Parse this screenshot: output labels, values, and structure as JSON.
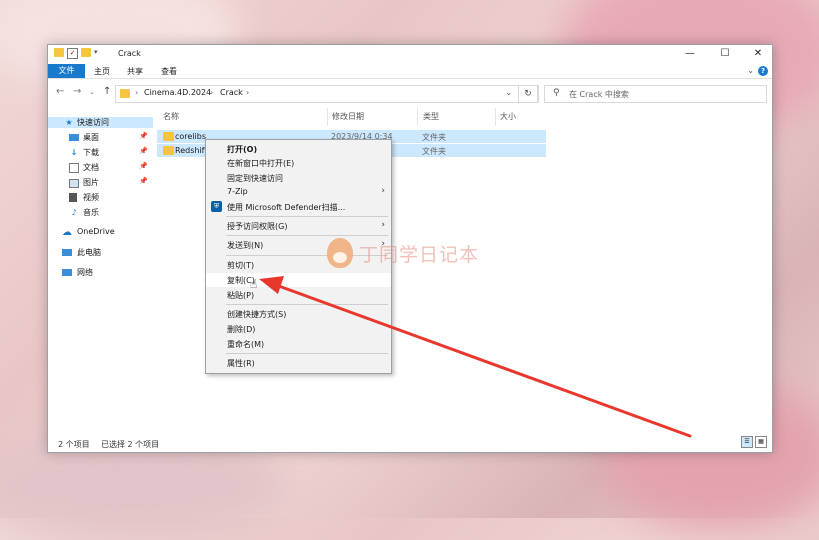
{
  "window": {
    "title": "Crack",
    "controls": [
      "—",
      "☐",
      "✕"
    ]
  },
  "ribbon": {
    "file_tab": "文件",
    "tabs": [
      "主页",
      "共享",
      "查看"
    ],
    "collapse_chevron": "⌄",
    "help": "?"
  },
  "address": {
    "crumbs": [
      "Cinema.4D.2024",
      "Crack"
    ],
    "separators": [
      "›",
      "›",
      "›"
    ],
    "search_placeholder": "在 Crack 中搜索"
  },
  "sidebar": {
    "items": [
      {
        "label": "快速访问",
        "icon": "star-icon",
        "pinned": false
      },
      {
        "label": "桌面",
        "icon": "desktop-icon",
        "pinned": true
      },
      {
        "label": "下载",
        "icon": "download-icon",
        "pinned": true
      },
      {
        "label": "文档",
        "icon": "document-icon",
        "pinned": true
      },
      {
        "label": "图片",
        "icon": "picture-icon",
        "pinned": true
      },
      {
        "label": "视频",
        "icon": "video-icon",
        "pinned": false
      },
      {
        "label": "音乐",
        "icon": "music-icon",
        "pinned": false
      },
      {
        "label": "OneDrive",
        "icon": "cloud-icon",
        "pinned": false
      },
      {
        "label": "此电脑",
        "icon": "computer-icon",
        "pinned": false
      },
      {
        "label": "网络",
        "icon": "network-icon",
        "pinned": false
      }
    ]
  },
  "columns": [
    "名称",
    "修改日期",
    "类型",
    "大小"
  ],
  "files": [
    {
      "name": "corelibs",
      "date": "2023/9/14 0:34",
      "type": "文件夹"
    },
    {
      "name": "Redshift",
      "date": "",
      "type": "文件夹"
    }
  ],
  "status": {
    "count": "2 个项目",
    "selected": "已选择 2 个项目"
  },
  "context_menu": {
    "items": [
      {
        "label": "打开(O)",
        "bold": true
      },
      {
        "label": "在新窗口中打开(E)"
      },
      {
        "label": "固定到快速访问"
      },
      {
        "label": "7-Zip",
        "submenu": true
      },
      {
        "label": "使用 Microsoft Defender扫描...",
        "icon": "defender-icon"
      },
      {
        "label": "授予访问权限(G)",
        "submenu": true
      },
      {
        "label": "发送到(N)",
        "submenu": true
      },
      {
        "label": "剪切(T)"
      },
      {
        "label": "复制(C)",
        "highlighted": true
      },
      {
        "label": "粘贴(P)"
      },
      {
        "label": "创建快捷方式(S)"
      },
      {
        "label": "删除(D)"
      },
      {
        "label": "重命名(M)"
      },
      {
        "label": "属性(R)"
      }
    ]
  },
  "watermark": {
    "text": "丁同学日记本"
  },
  "colors": {
    "accent": "#1979ca",
    "selection": "#cce8ff",
    "folder": "#f5c542",
    "arrow": "#e8372c"
  }
}
